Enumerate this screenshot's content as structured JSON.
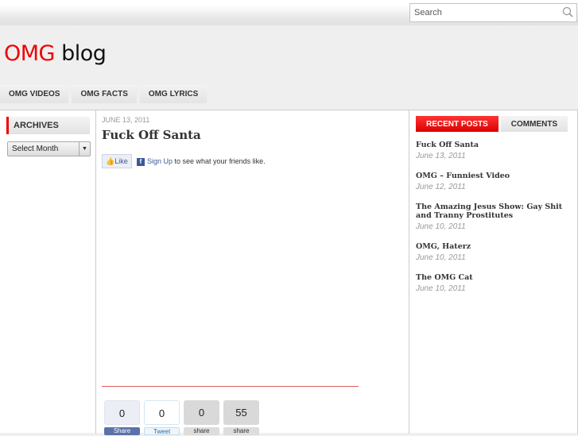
{
  "search": {
    "placeholder": "Search"
  },
  "logo": {
    "part1": "OMG",
    "part2": "blog"
  },
  "nav": [
    "OMG VIDEOS",
    "OMG FACTS",
    "OMG LYRICS"
  ],
  "sidebar": {
    "archives_title": "ARCHIVES",
    "select_value": "Select Month"
  },
  "post": {
    "date": "JUNE 13, 2011",
    "title": "Fuck Off Santa",
    "like": "Like",
    "signup": "Sign Up",
    "friends_text": " to see what your friends like."
  },
  "share": {
    "counts": [
      "0",
      "0",
      "0",
      "55"
    ],
    "labels": [
      "Share",
      "Tweet",
      "share",
      "share"
    ]
  },
  "right": {
    "tabs": [
      "RECENT POSTS",
      "COMMENTS"
    ],
    "posts": [
      {
        "title": "Fuck Off Santa",
        "date": "June 13, 2011"
      },
      {
        "title": "OMG – Funniest Video",
        "date": "June 12, 2011"
      },
      {
        "title": "The Amazing Jesus Show: Gay Shit and Tranny Prostitutes",
        "date": "June 10, 2011"
      },
      {
        "title": "OMG, Haterz",
        "date": "June 10, 2011"
      },
      {
        "title": "The OMG Cat",
        "date": "June 10, 2011"
      }
    ]
  },
  "colors": {
    "accent": "#e00000"
  }
}
